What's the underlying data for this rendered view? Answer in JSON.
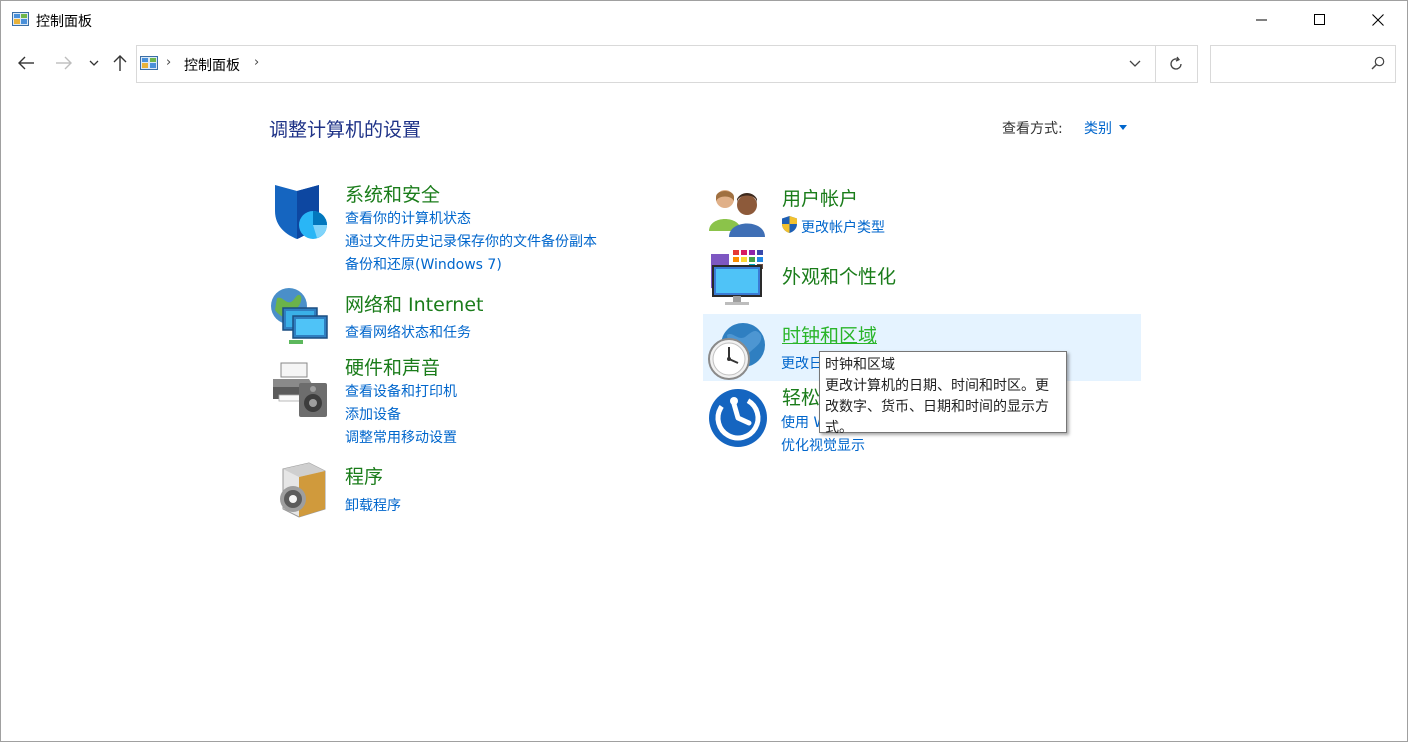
{
  "window": {
    "title": "控制面板"
  },
  "address": {
    "crumb": "控制面板",
    "search_placeholder": ""
  },
  "page": {
    "title": "调整计算机的设置",
    "view_label": "查看方式:",
    "view_value": "类别"
  },
  "left_categories": [
    {
      "title": "系统和安全",
      "links": [
        "查看你的计算机状态",
        "通过文件历史记录保存你的文件备份副本",
        "备份和还原(Windows 7)"
      ]
    },
    {
      "title": "网络和 Internet",
      "links": [
        "查看网络状态和任务"
      ]
    },
    {
      "title": "硬件和声音",
      "links": [
        "查看设备和打印机",
        "添加设备",
        "调整常用移动设置"
      ]
    },
    {
      "title": "程序",
      "links": [
        "卸载程序"
      ]
    }
  ],
  "right_categories": [
    {
      "title": "用户帐户",
      "links": [
        "更改帐户类型"
      ]
    },
    {
      "title": "外观和个性化",
      "links": []
    },
    {
      "title": "时钟和区域",
      "links": [
        "更改日"
      ]
    },
    {
      "title": "轻松",
      "links": [
        "使用 W",
        "优化视觉显示"
      ]
    }
  ],
  "tooltip": {
    "title": "时钟和区域",
    "body": "更改计算机的日期、时间和时区。更改数字、货币、日期和时间的显示方式。"
  },
  "colors": {
    "category_title": "#1a7c1a",
    "link": "#0066cc",
    "page_title": "#1e3287",
    "hover_bg": "#e5f3ff"
  }
}
